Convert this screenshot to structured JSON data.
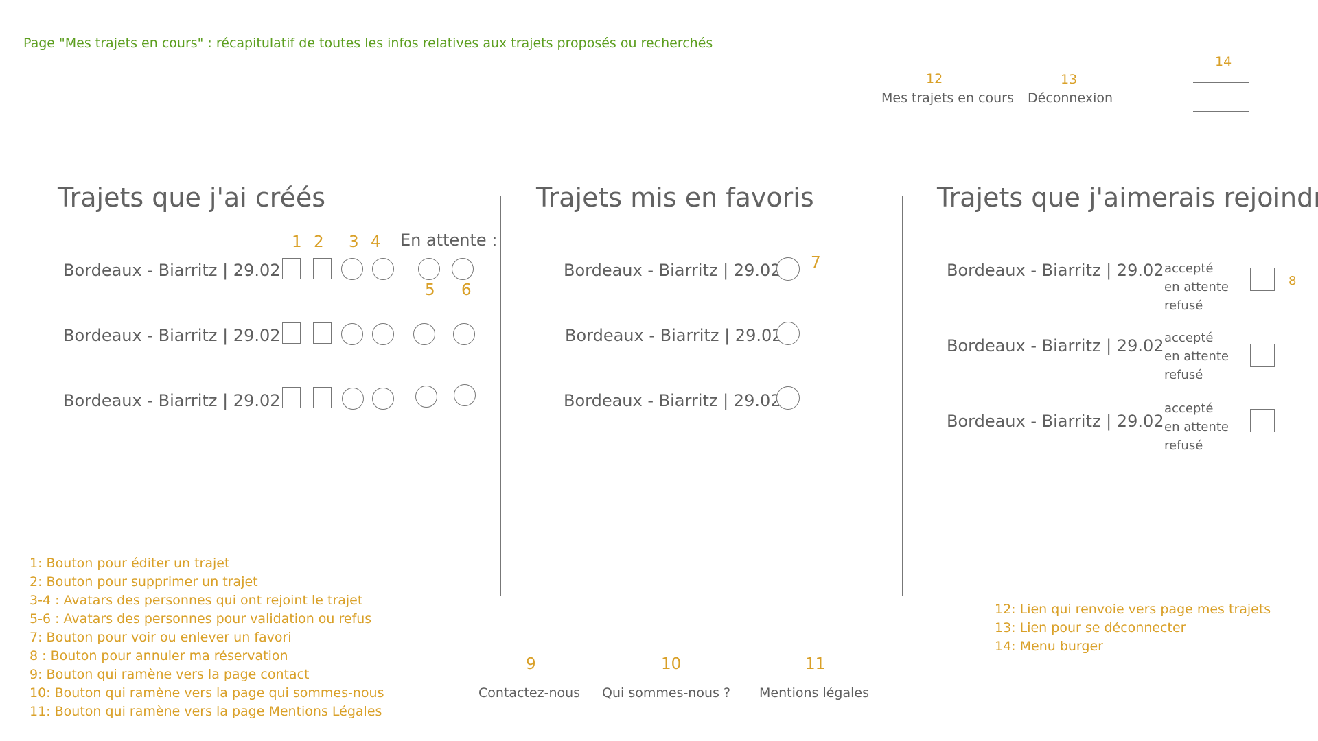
{
  "page_caption": "Page \"Mes trajets en cours\" : récapitulatif de toutes les infos relatives aux trajets proposés ou recherchés",
  "nav": {
    "num_mes_trajets": "12",
    "mes_trajets": "Mes trajets en cours",
    "num_deconnexion": "13",
    "deconnexion": "Déconnexion",
    "num_burger": "14"
  },
  "col1": {
    "title": "Trajets que j'ai créés",
    "en_attente": "En attente :",
    "nums": {
      "n1": "1",
      "n2": "2",
      "n3": "3",
      "n4": "4",
      "n5": "5",
      "n6": "6"
    },
    "trips": [
      "Bordeaux - Biarritz | 29.02",
      "Bordeaux - Biarritz | 29.02",
      "Bordeaux - Biarritz | 29.02"
    ]
  },
  "col2": {
    "title": "Trajets mis en favoris",
    "num7": "7",
    "trips": [
      "Bordeaux - Biarritz | 29.02",
      "Bordeaux - Biarritz | 29.02",
      "Bordeaux - Biarritz | 29.02"
    ]
  },
  "col3": {
    "title": "Trajets que j'aimerais rejoindre",
    "num8": "8",
    "trips": [
      "Bordeaux - Biarritz | 29.02",
      "Bordeaux - Biarritz | 29.02",
      "Bordeaux - Biarritz | 29.02"
    ],
    "status": {
      "accepted": "accepté",
      "pending": "en attente",
      "refused": "refusé"
    }
  },
  "legend_left": [
    "1: Bouton pour éditer un trajet",
    "2: Bouton pour supprimer un trajet",
    "3-4 : Avatars des personnes qui ont rejoint le trajet",
    "5-6 : Avatars des personnes pour validation ou refus",
    "7: Bouton pour voir ou enlever un favori",
    "8 : Bouton pour annuler ma réservation",
    "9: Bouton qui ramène vers la page contact",
    "10: Bouton qui ramène vers la page qui sommes-nous",
    "11: Bouton qui ramène vers la page Mentions Légales"
  ],
  "legend_right": [
    "12: Lien qui renvoie vers page mes trajets",
    "13: Lien pour se déconnecter",
    "14: Menu burger"
  ],
  "footer": {
    "num9": "9",
    "contact": "Contactez-nous",
    "num10": "10",
    "qui": "Qui sommes-nous ?",
    "num11": "11",
    "mentions": "Mentions légales"
  }
}
